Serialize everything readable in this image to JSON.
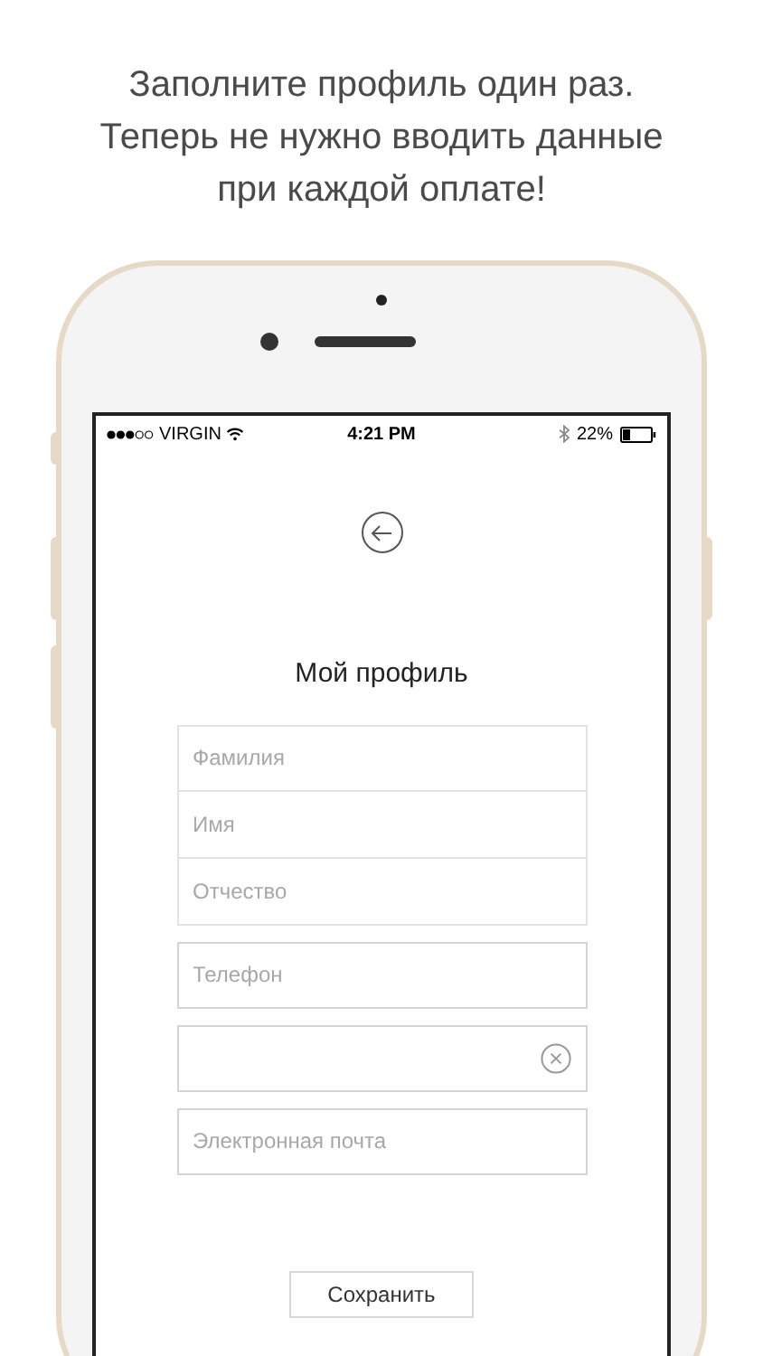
{
  "caption": "Заполните профиль один раз. Теперь не нужно вводить данные при каждой оплате!",
  "status_bar": {
    "carrier": "VIRGIN",
    "time": "4:21 PM",
    "battery": "22%"
  },
  "title": "Мой профиль",
  "name_fields": [
    {
      "placeholder": "Фамилия"
    },
    {
      "placeholder": "Имя"
    },
    {
      "placeholder": "Отчество"
    }
  ],
  "fields": [
    {
      "kind": "text",
      "placeholder": "Телефон"
    },
    {
      "kind": "clearable"
    },
    {
      "kind": "text",
      "placeholder": "Электронная почта"
    }
  ],
  "save_button": "Сохранить"
}
